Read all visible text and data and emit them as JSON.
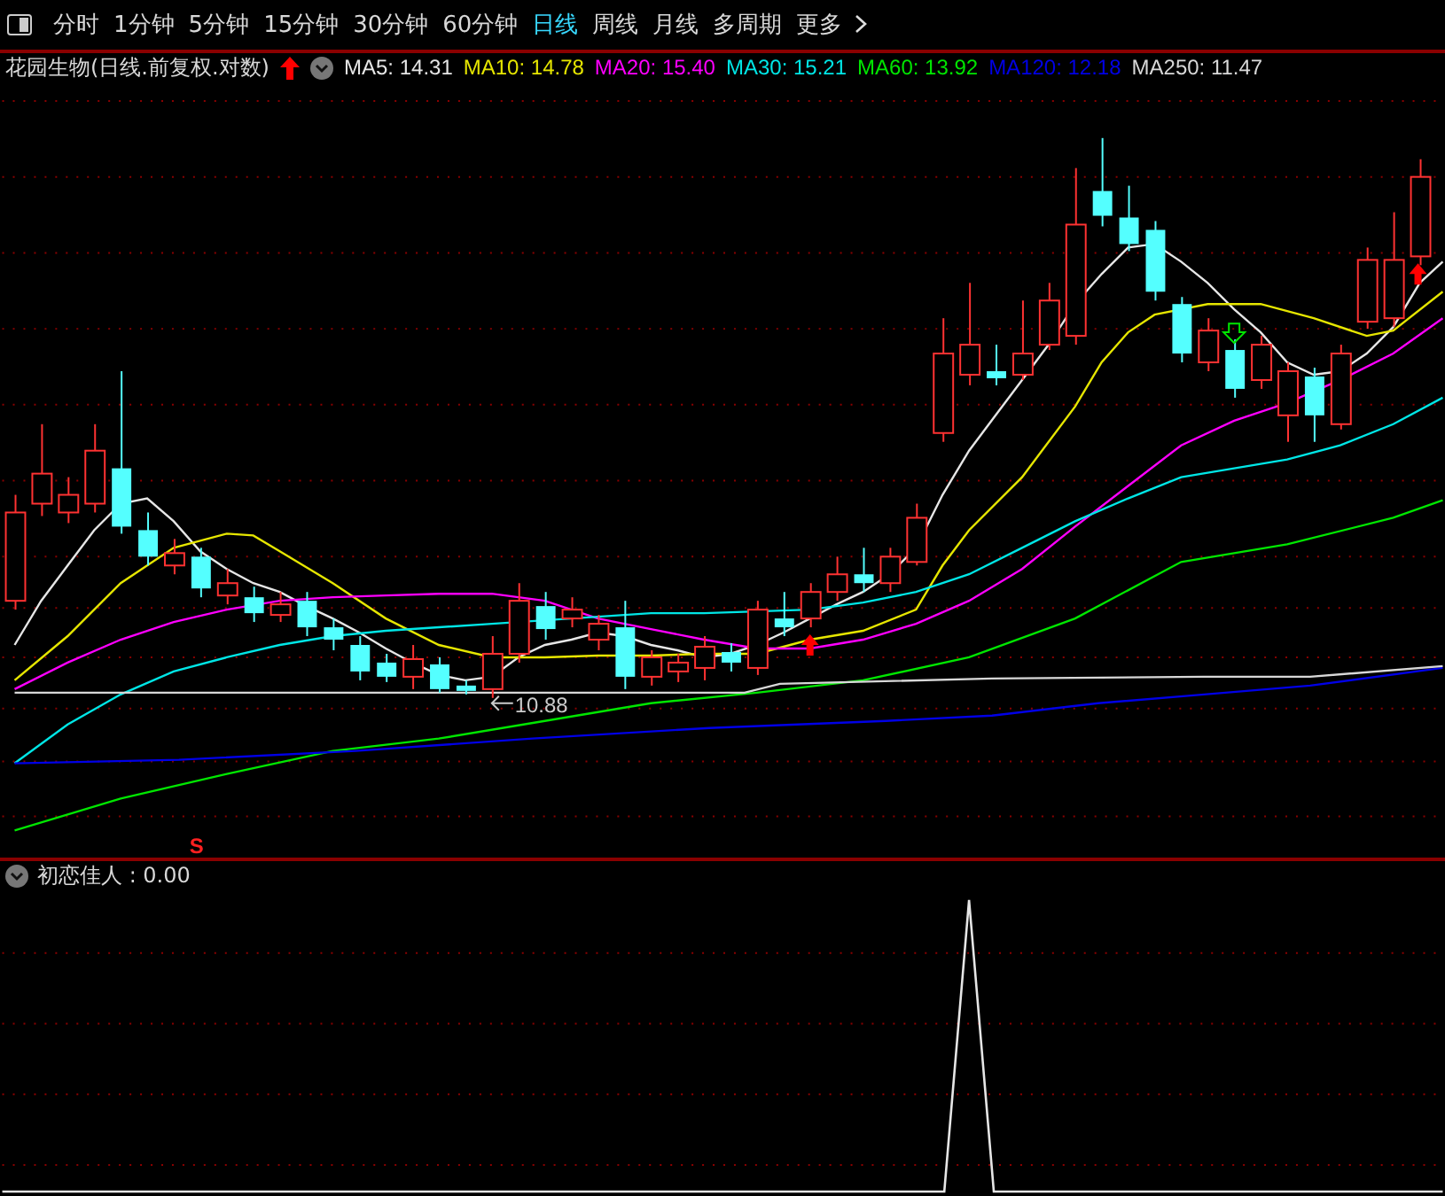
{
  "toolbar": {
    "tabs": [
      {
        "label": "分时",
        "selected": false
      },
      {
        "label": "1分钟",
        "selected": false
      },
      {
        "label": "5分钟",
        "selected": false
      },
      {
        "label": "15分钟",
        "selected": false
      },
      {
        "label": "30分钟",
        "selected": false
      },
      {
        "label": "60分钟",
        "selected": false
      },
      {
        "label": "日线",
        "selected": true
      },
      {
        "label": "周线",
        "selected": false
      },
      {
        "label": "月线",
        "selected": false
      },
      {
        "label": "多周期",
        "selected": false
      },
      {
        "label": "更多",
        "selected": false
      }
    ]
  },
  "legend": {
    "title": "花园生物(日线.前复权.对数)",
    "indicators": [
      {
        "label": "MA5: 14.31",
        "color": "#e6e6e6"
      },
      {
        "label": "MA10: 14.78",
        "color": "#e6e600"
      },
      {
        "label": "MA20: 15.40",
        "color": "#ff00ff"
      },
      {
        "label": "MA30: 15.21",
        "color": "#00e6e6"
      },
      {
        "label": "MA60: 13.92",
        "color": "#00e600"
      },
      {
        "label": "MA120: 12.18",
        "color": "#0000e6"
      },
      {
        "label": "MA250: 11.47",
        "color": "#d8d8d8"
      }
    ]
  },
  "chart": {
    "price_label": "10.88",
    "sell_mark": "S"
  },
  "indicator_panel": {
    "legend": "初恋佳人 : 0.00"
  }
}
